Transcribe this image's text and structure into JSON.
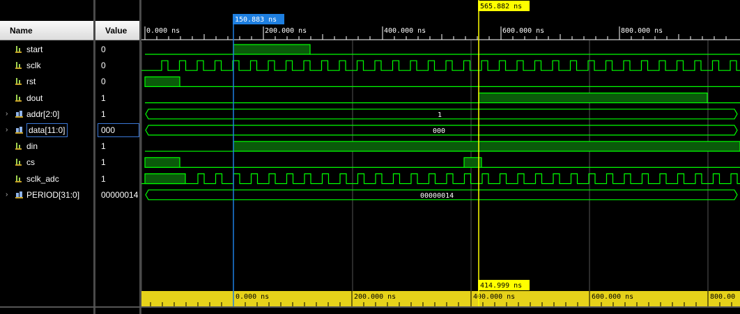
{
  "columns": {
    "name": "Name",
    "value": "Value"
  },
  "signals": [
    {
      "name": "start",
      "value": "0",
      "kind": "bit",
      "expandable": false
    },
    {
      "name": "sclk",
      "value": "0",
      "kind": "bit",
      "expandable": false
    },
    {
      "name": "rst",
      "value": "0",
      "kind": "bit",
      "expandable": false
    },
    {
      "name": "dout",
      "value": "1",
      "kind": "bit",
      "expandable": false
    },
    {
      "name": "addr[2:0]",
      "value": "1",
      "kind": "bus",
      "expandable": true,
      "bus_text": "1"
    },
    {
      "name": "data[11:0]",
      "value": "000",
      "kind": "bus",
      "expandable": true,
      "bus_text": "000",
      "selected": true
    },
    {
      "name": "din",
      "value": "1",
      "kind": "bit",
      "expandable": false
    },
    {
      "name": "cs",
      "value": "1",
      "kind": "bit",
      "expandable": false
    },
    {
      "name": "sclk_adc",
      "value": "1",
      "kind": "bit",
      "expandable": false
    },
    {
      "name": "PERIOD[31:0]",
      "value": "00000014",
      "kind": "bus",
      "expandable": true,
      "bus_text": "00000014"
    }
  ],
  "top_ruler": {
    "labels": [
      "0.000 ns",
      "200.000 ns",
      "400.000 ns",
      "600.000 ns",
      "800.000 ns"
    ]
  },
  "cursors": {
    "blue": {
      "label": "150.883 ns",
      "color": "#1e7fe0"
    },
    "yellow": {
      "label": "565.882 ns",
      "color": "#ffff00",
      "bottom_label": "414.999 ns"
    }
  },
  "bottom_ruler": {
    "labels": [
      "0.000 ns",
      "200.000 ns",
      "400.000 ns",
      "600.000 ns",
      "800.00"
    ]
  },
  "colors": {
    "wave": "#00ff00",
    "wave_fill": "#0a5a0a",
    "background": "#000000",
    "bottom_ruler": "#e6d21a"
  }
}
